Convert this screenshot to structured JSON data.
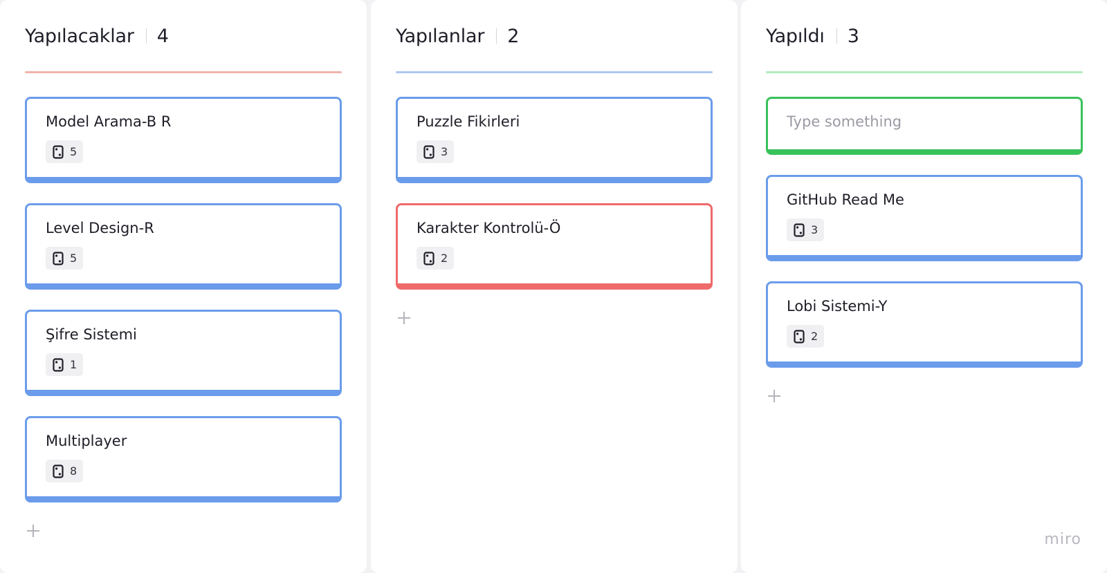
{
  "columns": [
    {
      "title": "Yapılacaklar",
      "count": "4",
      "line_color": "#f2b3ad",
      "cards": [
        {
          "title": "Model Arama-B R",
          "badge": "5",
          "color": "blue"
        },
        {
          "title": "Level Design-R",
          "badge": "5",
          "color": "blue"
        },
        {
          "title": "Şifre Sistemi",
          "badge": "1",
          "color": "blue"
        },
        {
          "title": "Multiplayer",
          "badge": "8",
          "color": "blue"
        }
      ]
    },
    {
      "title": "Yapılanlar",
      "count": "2",
      "line_color": "#aec6f3",
      "cards": [
        {
          "title": "Puzzle Fikirleri",
          "badge": "3",
          "color": "blue"
        },
        {
          "title": "Karakter Kontrolü-Ö",
          "badge": "2",
          "color": "red"
        }
      ]
    },
    {
      "title": "Yapıldı",
      "count": "3",
      "line_color": "#b2ebc1",
      "draft": {
        "placeholder": "Type something",
        "value": ""
      },
      "cards": [
        {
          "title": "GitHub Read Me",
          "badge": "3",
          "color": "blue"
        },
        {
          "title": "Lobi Sistemi-Y",
          "badge": "2",
          "color": "blue"
        }
      ]
    }
  ],
  "icons": {
    "badge": "card-estimate-icon",
    "add": "plus-icon"
  },
  "colors": {
    "card_blue": "#6b9ceb",
    "card_red": "#ef6a6a",
    "draft_green": "#38c25a"
  },
  "watermark": "miro"
}
